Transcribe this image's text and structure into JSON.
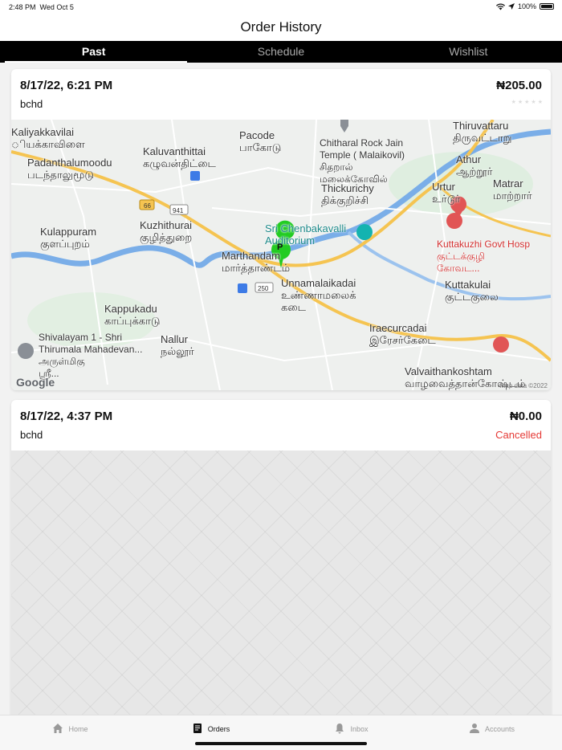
{
  "status_bar": {
    "time": "2:48 PM",
    "date": "Wed Oct 5",
    "battery": "100%",
    "battery_level": 1.0
  },
  "header": {
    "title": "Order History"
  },
  "tabs": [
    {
      "label": "Past",
      "active": true
    },
    {
      "label": "Schedule",
      "active": false
    },
    {
      "label": "Wishlist",
      "active": false
    }
  ],
  "orders": [
    {
      "date": "8/17/22, 6:21 PM",
      "name": "bchd",
      "amount": "₦205.00",
      "rating": 0
    },
    {
      "date": "8/17/22, 4:37 PM",
      "name": "bchd",
      "amount": "₦0.00",
      "status": "Cancelled"
    }
  ],
  "map": {
    "labels": {
      "kaliyakkavilai": "Kaliyakkavilai\nியக்காவிளை",
      "pacode": "Pacode\nபாகோடு",
      "chitharal": "Chitharal Rock Jain\nTemple ( Malaikovil)\nசிதறால்\nமலைக்கோவில்",
      "thiruvattaru": "Thiruvattaru\nதிருவட்டாறு",
      "kaluvanthittai": "Kaluvanthittai\nகழுவன்திட்டை",
      "padanthalumoodu": "Padanthalumoodu\nபடந்தாலுமூடு",
      "athur": "Athur\nஆற்றூர்",
      "thickurichy": "Thickurichy\nதிக்குறிச்சி",
      "urtur": "Urtur\nஉர்டூர்",
      "matrar": "Matrar\nமாற்றார்",
      "kuzhithurai": "Kuzhithurai\nகுழித்துறை",
      "kulappuram": "Kulappuram\nகுளப்புறம்",
      "chenbakavalli": "Sri Chenbakavalli\nAuditorium",
      "kuttakuzhi": "Kuttakuzhi Govt Hosp\nகுட்டக்குழி\nகோவட...",
      "marthandam": "Marthandam\nமார்த்தாண்டம்",
      "unnamalaikadai": "Unnamalaikadai\nஉண்ணாமலைக்\nகடை",
      "kuttakulai": "Kuttakulai\nகுட்டகுலை",
      "kappukadu": "Kappukadu\nகாப்புக்காடு",
      "shivalayam": "Shivalayam 1 - Shri\nThirumala Mahadevan...\nஅருள்மிகு\nஸ்ரீ...",
      "nallur": "Nallur\nநல்லூர்",
      "iraecurcadai": "Iraecurcadai\nஇரேசர்கேடை",
      "valvaithankoshtam": "Valvaithankoshtam\nவாழவைத்தான்கோஷ்டம்"
    },
    "road_labels": {
      "r66": "66",
      "r941": "941",
      "r250": "250"
    },
    "pin_letter": "P",
    "google": "Google",
    "map_data": "Map data ©2022"
  },
  "bottom_nav": [
    {
      "label": "Home",
      "icon": "home-icon",
      "active": false
    },
    {
      "label": "Orders",
      "icon": "orders-icon",
      "active": true
    },
    {
      "label": "Inbox",
      "icon": "bell-icon",
      "active": false
    },
    {
      "label": "Accounts",
      "icon": "person-icon",
      "active": false
    }
  ],
  "colors": {
    "accent": "#000000",
    "cancelled": "#e53935",
    "pin": "#22cc22",
    "river": "#7aaee8",
    "highway": "#f5c451"
  }
}
